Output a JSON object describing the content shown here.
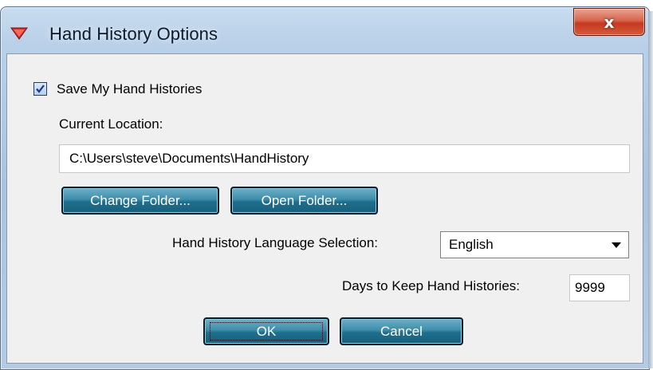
{
  "window": {
    "title": "Hand History Options",
    "close_label": "x",
    "icon": "red-triangle-icon"
  },
  "save": {
    "label": "Save My Hand Histories",
    "checked": true
  },
  "location": {
    "label": "Current Location:",
    "value": "C:\\Users\\steve\\Documents\\HandHistory"
  },
  "buttons": {
    "change_folder": "Change Folder...",
    "open_folder": "Open Folder...",
    "ok": "OK",
    "cancel": "Cancel"
  },
  "language": {
    "label": "Hand History Language Selection:",
    "selected": "English"
  },
  "days": {
    "label": "Days to Keep Hand Histories:",
    "value": "9999"
  },
  "colors": {
    "button_accent": "#1f6f8e",
    "close_button": "#c5391f",
    "title_icon": "#d62a2a"
  }
}
